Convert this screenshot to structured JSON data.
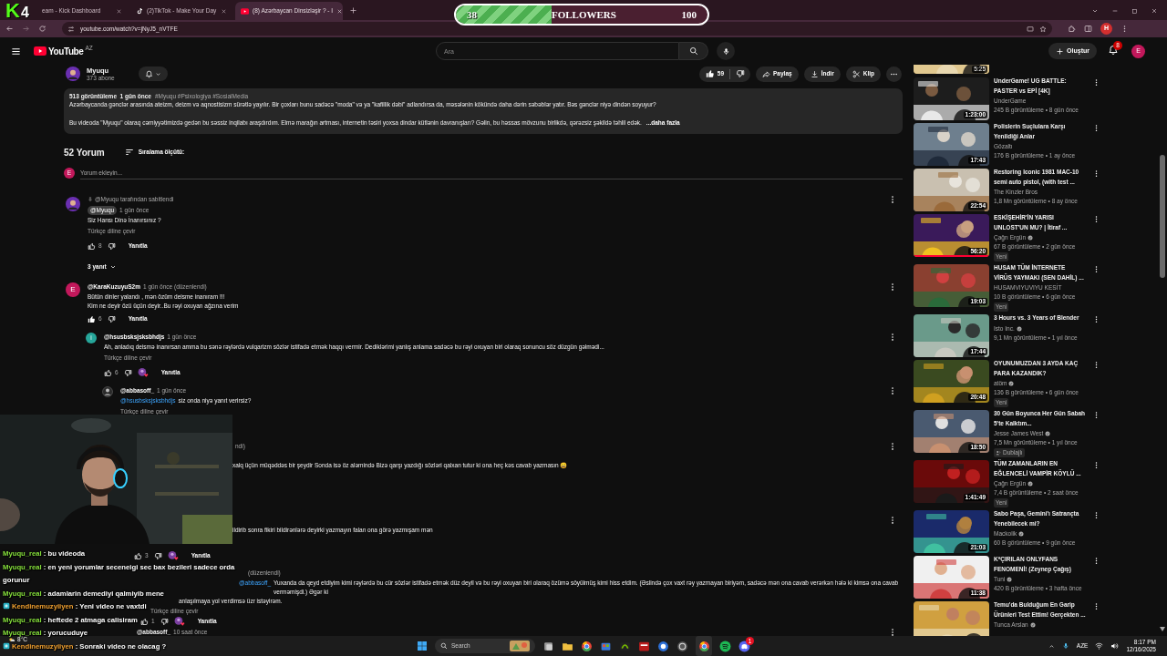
{
  "overlay": {
    "logo": "K",
    "count": "4",
    "followers": {
      "current": "38",
      "label": "FOLLOWERS",
      "goal": "100",
      "level": 0.38
    }
  },
  "browser": {
    "tabs": [
      {
        "kind": "kick",
        "title": "eam - Kick Dashboard",
        "selected": false
      },
      {
        "kind": "tiktok",
        "title": "(2)TikTok - Make Your Day",
        "selected": false
      },
      {
        "kind": "youtube",
        "title": "(8) Azərbaycan Dinsizləşir ? - I",
        "selected": true
      }
    ],
    "url": "youtube.com/watch?v=jNyJ5_nVTFE",
    "profile": "H"
  },
  "header": {
    "logo": "YouTube",
    "region": "AZ",
    "search_placeholder": "Ara",
    "create": "Oluştur",
    "notifications": "8",
    "avatar": "E"
  },
  "video": {
    "channel": "Myuqu",
    "subscribers": "373 abone",
    "likes": "59",
    "share": "Paylaş",
    "download": "İndir",
    "clip": "Klip"
  },
  "description": {
    "stats": "513 görüntüleme  1 gün önce",
    "tags": "#Myuqu #Psixologiya #SosialMedia",
    "paragraphs": [
      "Azərbaycanda gənclər arasında ateizm, deizm və aqnostisizm sürətlə yayılır. Bir çoxları bunu sadəcə \"moda\" və ya \"kafillik dəbi\" adlandırsa da, məsələnin kökündə daha dərin səbəblər yatır. Bəs gənclər niyə dindən soyuyur?",
      "Bu videoda \"Myuqu\" olaraq cəmiyyətimizdə gedən bu səssiz inqilabı araşdırdım. Elmə marağın artması, internetin təsiri yoxsa dindar kütlənin davranışları? Gəlin, bu həssas mövzunu birlikdə, qərəzsiz şəkildə təhlil edək."
    ],
    "more": "...daha fazla"
  },
  "comments_section": {
    "count": "52 Yorum",
    "sort": "Sıralama ölçütü:",
    "avatar": "E",
    "placeholder": "Yorum ekleyin..."
  },
  "comments": [
    {
      "kind": "comment",
      "pinned": "@Myuqu tarafından sabitlendi",
      "author": "@Myuqu",
      "owner": true,
      "time": "1 gün önce",
      "lines": [
        "Siz Hansı Dinə İnanırsınız ?"
      ],
      "translate": "Türkçe diline çevir",
      "likes": "8",
      "liked": false,
      "hearted": false,
      "reply": "Yanıtla",
      "replies": "3 yanıt"
    },
    {
      "kind": "comment",
      "author": "@KaraKuzuyuS2m",
      "owner": false,
      "avatar": "E",
      "color": "#c2185b",
      "time": "1 gün önce (düzenlendi)",
      "lines": [
        "Bütün dinler yalandı , mən özüm deisme inanıram !!!",
        "Kim ne deyir özü üçün deyir..Bu rəyi oxuyan ağzına verim"
      ],
      "likes": "6",
      "liked": true,
      "hearted": false,
      "reply": "Yanıtla",
      "children": [
        {
          "kind": "comment",
          "author": "@hsusbsksjsksbhdjs",
          "owner": false,
          "avatar": "i",
          "color": "#26a69a",
          "time": "1 gün önce",
          "lines": [
            "Ah, anladıq deismə inanırsan amma bu sənə rəylərdə vulqarizm sözlər istifadə etmək haqqı vermir. Dediklərimi yanlış anlama sadəcə bu rəyi oxuyan biri olaraq sonuncu söz düzgün gəlmədi..."
          ],
          "translate": "Türkçe diline çevir",
          "likes": "6",
          "liked": false,
          "hearted": true,
          "reply": "Yanıtla",
          "children": [
            {
              "kind": "comment",
              "author": "@abbasoff_",
              "owner": false,
              "time": "1 gün önce",
              "mention": "@hsusbsksjsksbhdjs",
              "lines": [
                "siz onda niyə yanıt verirsiz?"
              ],
              "translate": "Türkçe diline çevir"
            }
          ]
        }
      ]
    },
    {
      "kind": "covered",
      "meta": "ndi)",
      "lines": [
        "xalq üçün müqəddəs bir şeydir Sonda isə öz aləmində Bizə  qarşı yazdığı sözləri  qalxan tutur ki ona heç kəs cavab yazmasın 😄"
      ]
    },
    {
      "kind": "covered",
      "lines": [
        "ildirib sonra fikiri bildirənlərə deyirki yazmayın falan ona görə yazmışam mən"
      ],
      "likes": "3",
      "liked": false,
      "hearted": true,
      "reply": "Yanıtla",
      "children": [
        {
          "kind": "covered",
          "meta": "(düzenlendi)",
          "mention": "@abbasoff_",
          "lines": [
            "Yuxanda da qeyd etdiyim kimi rəylərdə bu cür sözlər istifadə etmək düz deyil və bu rəyi oxuyan biri olaraq özümə söyülmüş kimi hiss etdim. (Əslində çox vaxt rəy yazmayan biriyəm, sadəcə mən ona cavab verərkən hələ ki kimsə ona cavab verməmişdi.) Əgər ki",
            "anlaşılmaya yol verdimsə üzr istəyirəm."
          ],
          "translate": "Türkçe diline çevir",
          "likes": "1",
          "liked": false,
          "hearted": true,
          "reply": "Yanıtla"
        },
        {
          "kind": "comment",
          "author": "@abbasoff_",
          "owner": false,
          "time": "10 saat önce"
        }
      ]
    }
  ],
  "chat": [
    {
      "user": "Myuqu_real",
      "color": "#86e03c",
      "badge": false,
      "message": ": bu videoda"
    },
    {
      "user": "Myuqu_real",
      "color": "#86e03c",
      "badge": false,
      "message": ": en yeni yorumlar seceneigi sec bax bezileri sadece orda gorunur"
    },
    {
      "user": "Myuqu_real",
      "color": "#86e03c",
      "badge": false,
      "message": ": adamlarin demediyi qalmiyib mene"
    },
    {
      "user": "Kendinemuzyiiyen",
      "color": "#f0a030",
      "badge": true,
      "message": ": Yeni video ne vaxtdi"
    },
    {
      "user": "Myuqu_real",
      "color": "#86e03c",
      "badge": false,
      "message": ": heftede 2 atmaga calisiram"
    },
    {
      "user": "Myuqu_real",
      "color": "#86e03c",
      "badge": false,
      "message": ": yorucuduye"
    },
    {
      "user": "Kendinemuzyiiyen",
      "color": "#f0a030",
      "badge": true,
      "message": ": Sonraki video ne olacag ?"
    }
  ],
  "sidebar": {
    "top_duration": "5:25",
    "videos": [
      {
        "title_lines": [
          "UnderGame! UG BATTLE:",
          "PASTER vs EPİ [4K]"
        ],
        "channel": "UnderGame",
        "verified": false,
        "stats": "245 B görüntüleme • 8 gün önce",
        "duration": "1:23:00"
      },
      {
        "title_lines": [
          "Polislerin Suçlulara Karşı",
          "Yenildiği Anlar"
        ],
        "channel": "Gözaltı",
        "verified": false,
        "stats": "176 B görüntüleme • 1 ay önce",
        "duration": "17:43"
      },
      {
        "title_lines": [
          "Restoring Iconic 1981 MAC-10",
          "semi auto pistol, (with test ..."
        ],
        "channel": "The Kinzler Bros",
        "verified": false,
        "stats": "1,8 Mn görüntüleme • 8 ay önce",
        "duration": "22:54"
      },
      {
        "title_lines": [
          "ESKİŞEHİR'İN YARISI",
          "UNLOST'UN MU? | İtiraf ..."
        ],
        "channel": "Çağrı Ergün",
        "verified": true,
        "stats": "67 B görüntüleme • 2 gün önce",
        "duration": "56:20",
        "badge": {
          "kind": "new",
          "label": "Yeni"
        },
        "level": 1
      },
      {
        "title_lines": [
          "HUSAM  TÜM İNTERNETE",
          "VİRÜS YAYMAKI (SEN DAHİL) ..."
        ],
        "channel": "HUSAMVIYUVIYU KESİT",
        "verified": false,
        "stats": "10 B görüntüleme • 6 gün önce",
        "duration": "19:03",
        "badge": {
          "kind": "new",
          "label": "Yeni"
        }
      },
      {
        "title_lines": [
          "3 Hours vs. 3 Years of Blender"
        ],
        "channel": "Isto Inc.",
        "verified": true,
        "stats": "9,1 Mn görüntüleme • 1 yıl önce",
        "duration": "17:44"
      },
      {
        "title_lines": [
          "OYUNUMUZDAN 3 AYDA KAÇ",
          "PARA KAZANDIK?"
        ],
        "channel": "atöm",
        "verified": true,
        "stats": "136 B görüntüleme • 6 gün önce",
        "duration": "20:48",
        "badge": {
          "kind": "new",
          "label": "Yeni"
        }
      },
      {
        "title_lines": [
          "30 Gün Boyunca Her Gün Sabah",
          "5'te Kalktım..."
        ],
        "channel": "Jesse James West",
        "verified": true,
        "stats": "7,5 Mn görüntüleme • 1 yıl önce",
        "duration": "18:50",
        "badge": {
          "kind": "dubbed",
          "label": "Dublajlı"
        }
      },
      {
        "title_lines": [
          "TÜM ZAMANLARIN EN",
          "EĞLENCELİ VAMPİR KÖYLÜ ..."
        ],
        "channel": "Çağrı Ergün",
        "verified": true,
        "stats": "7,4 B görüntüleme • 2 saat önce",
        "duration": "1:41:49",
        "badge": {
          "kind": "new",
          "label": "Yeni"
        }
      },
      {
        "title_lines": [
          "Sabo Paşa, Gemini'ı Satrançta",
          "Yenebilecek mi?"
        ],
        "channel": "Mackolik",
        "verified": true,
        "stats": "60 B görüntüleme • 9 gün önce",
        "duration": "21:03"
      },
      {
        "title_lines": [
          "K*ÇIRILAN ONLYFANS",
          "FENOMENİ! (Zeynep Çağış)"
        ],
        "channel": "Tuni",
        "verified": true,
        "stats": "420 B görüntüleme • 3 hafta önce",
        "duration": "11:38"
      },
      {
        "title_lines": [
          "Temu'da Bulduğum En Garip",
          "Ürünleri Test Ettim! Gerçekten ..."
        ],
        "channel": "Tunca Arslan",
        "verified": true
      }
    ]
  },
  "taskbar": {
    "weather": "8°C",
    "search": "Search",
    "app_badge": "1",
    "language": "AZE",
    "time": "8:17 PM",
    "date": "12/16/2025"
  }
}
